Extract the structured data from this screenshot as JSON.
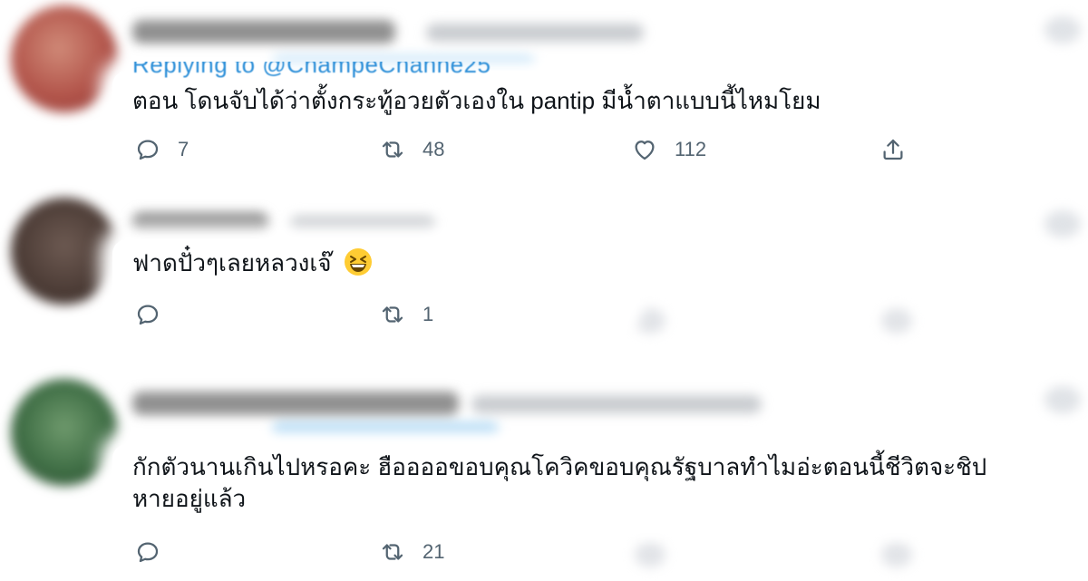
{
  "tweets": [
    {
      "reply_fragment": "Replying to @ChampeChanne25",
      "text": "ตอน โดนจับได้ว่าตั้งกระทู้อวยตัวเองใน pantip มีน้ำตาแบบนี้ไหมโยม",
      "replies": "7",
      "retweets": "48",
      "likes": "112"
    },
    {
      "text": "ฟาดปั๋วๆเลยหลวงเจ๊",
      "emoji": "grinning-squinting-face-emoji",
      "replies": "",
      "retweets": "1"
    },
    {
      "text_line1": "กักตัวนานเกินไปหรอคะ ฮืออออขอบคุณโควิคขอบคุณรัฐบาลทำไมอ่ะตอนนี้ชีวิตจะชิป",
      "text_line2": "หายอยู่แล้ว",
      "replies": "",
      "retweets": "21"
    }
  ],
  "icons": {
    "reply": "reply-icon",
    "retweet": "retweet-icon",
    "like": "heart-icon",
    "share": "share-icon"
  },
  "colors": {
    "text": "#0f1419",
    "muted": "#536471",
    "link": "#2d8fd8"
  }
}
